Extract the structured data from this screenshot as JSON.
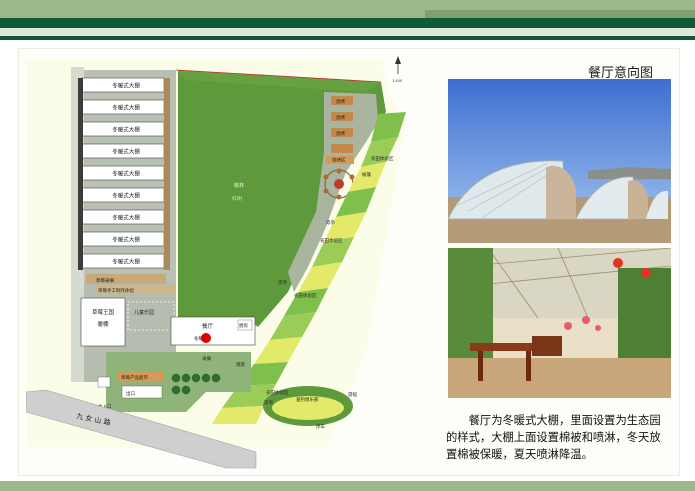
{
  "page": {
    "title": "餐厅意向图",
    "caption": "餐厅为冬暖式大棚，里面设置为生态园的样式，大棚上面设置棉被和喷淋，冬天放置棉被保暖，夏天喷淋降温。"
  },
  "map": {
    "greenhouses": [
      "冬暖式大棚",
      "冬暖式大棚",
      "冬暖式大棚",
      "冬暖式大棚",
      "冬暖式大棚",
      "冬暖式大棚",
      "冬暖式大棚",
      "冬暖式大棚",
      "冬暖式大棚"
    ],
    "labels": {
      "forest": "桃林",
      "forest_sub": "红树",
      "strawberry_picking": "草莓采摘",
      "strawberry_making": "草莓手工制作体验",
      "strawberry_kingdom": "草莓王国",
      "greenhouse_small": "暖棚",
      "playground": "儿童乐园",
      "restaurant": "餐厅",
      "restaurant_sub": "冬暖式",
      "kitchen": "厨房",
      "product_store": "草莓产品超市",
      "exit": "出口",
      "main_entrance": "主入口",
      "road": "九 女 山 路",
      "fishing": "垂钓俱乐部",
      "farm_top": "农田体验区",
      "farm_mid": "农田体验区",
      "farm_low": "农田体验区",
      "farm_bottom": "农田体验区",
      "pavilion1": "凉亭",
      "pavilion2": "凉亭",
      "pavilion3": "凉亭",
      "viewing": "观景",
      "boat": "游船",
      "parking": "停车",
      "bbq1": "烧烤",
      "bbq2": "烧烤",
      "bbq3": "烧烤",
      "bbq4": "烧烤区",
      "tent": "帐篷",
      "fruit": "采摘",
      "scale": "1:400"
    }
  },
  "icons": {
    "compass": "north-arrow-icon",
    "restaurant_marker": "red-dot-marker"
  },
  "colors": {
    "dark_green": "#0f5a3a",
    "light_green": "#9bb98a",
    "grass": "#5f9b3c",
    "yellow_field": "#e3ea6a",
    "red_marker": "#e00000"
  }
}
